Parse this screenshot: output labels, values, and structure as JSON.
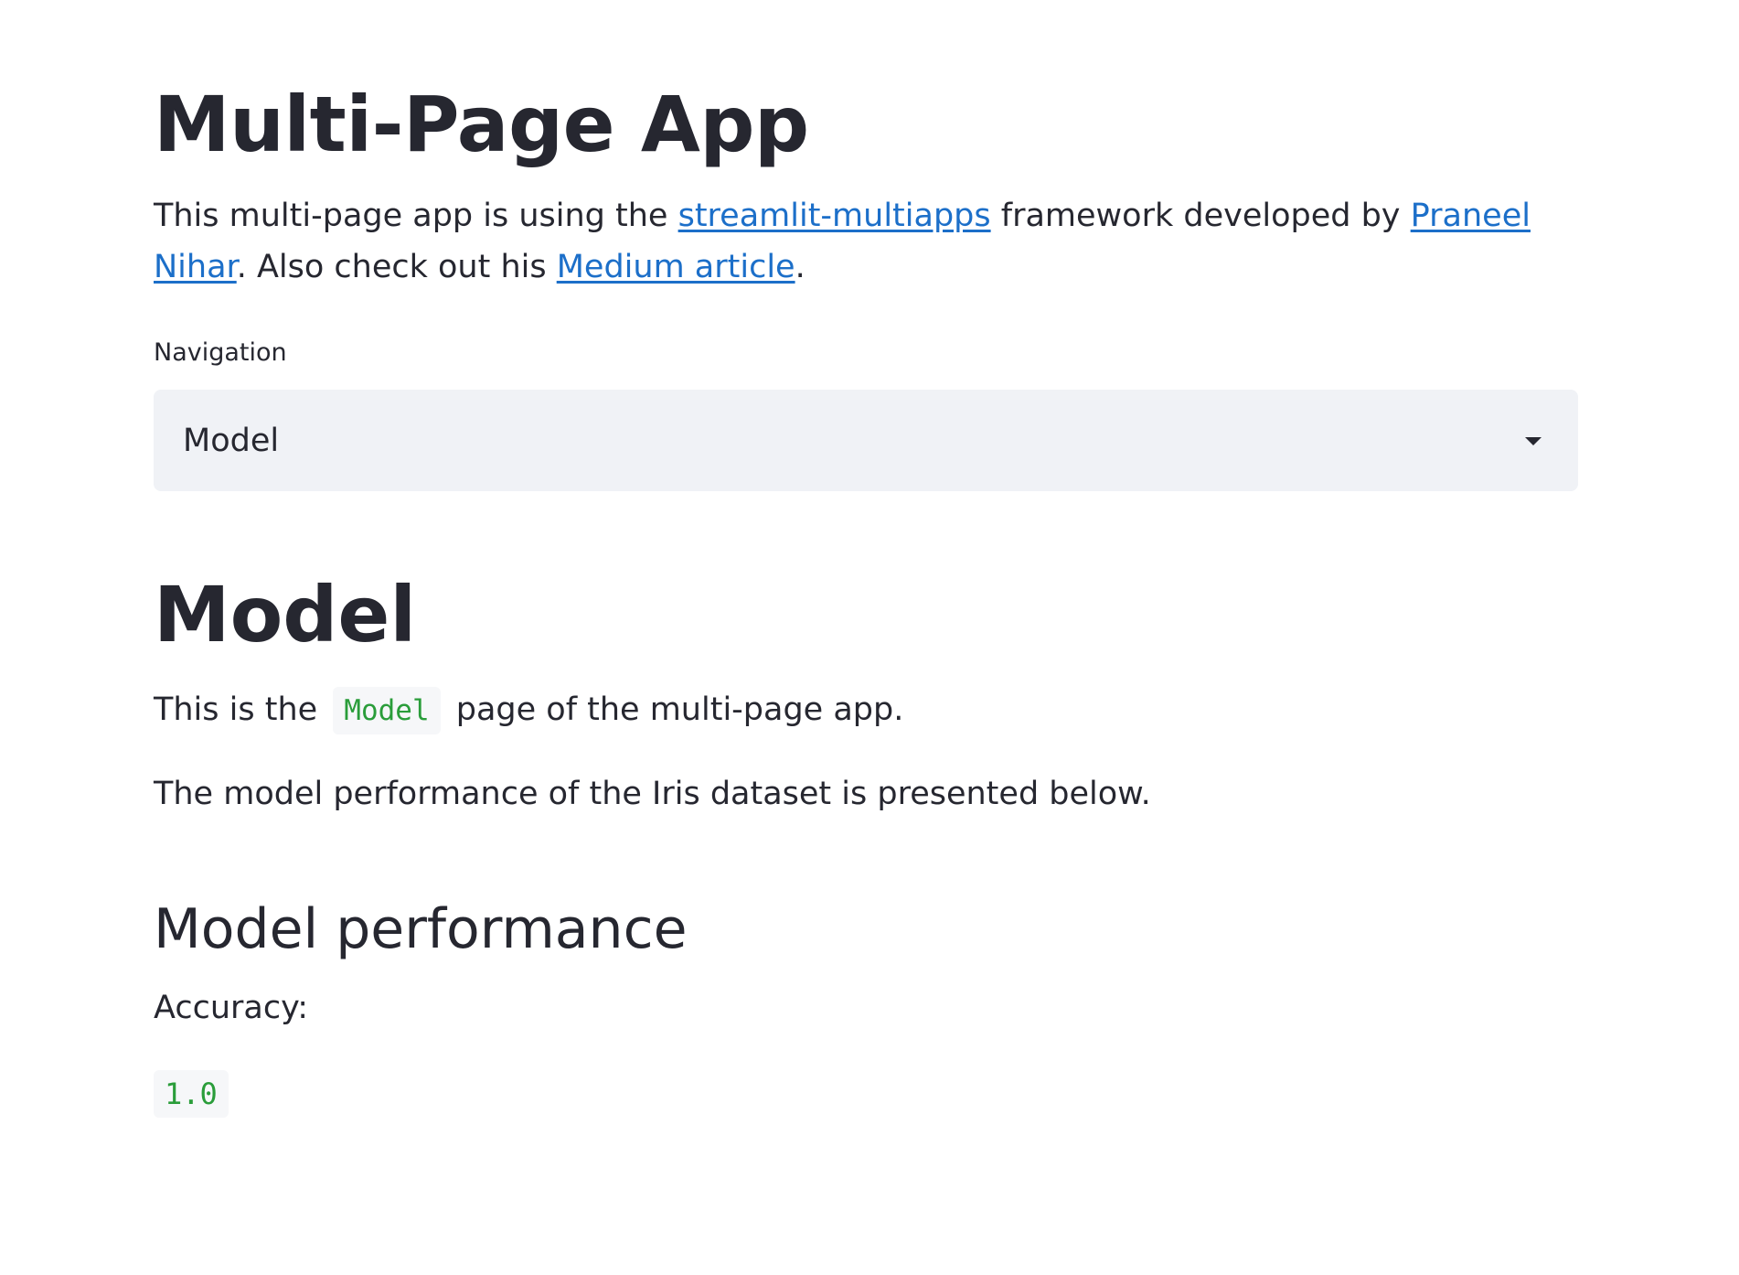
{
  "app": {
    "title": "Multi-Page App",
    "intro": {
      "text_1": "This multi-page app is using the ",
      "link_1": "streamlit-multiapps",
      "text_2": " framework developed by ",
      "link_2": "Praneel Nihar",
      "text_3": ". Also check out his ",
      "link_3": "Medium article",
      "text_4": "."
    }
  },
  "navigation": {
    "label": "Navigation",
    "selected": "Model",
    "icon": "chevron-down-icon"
  },
  "page": {
    "title": "Model",
    "para_1_before": "This is the ",
    "para_1_code": "Model",
    "para_1_after": " page of the multi-page app.",
    "para_2": "The model performance of the Iris dataset is presented below.",
    "section_title": "Model performance",
    "metric_label": "Accuracy:",
    "metric_value": "1.0"
  },
  "colors": {
    "text": "#262730",
    "link": "#1c6fc9",
    "select_bg": "#f0f2f6",
    "code_text": "#2a9d3a",
    "code_bg": "#f6f7f9"
  }
}
